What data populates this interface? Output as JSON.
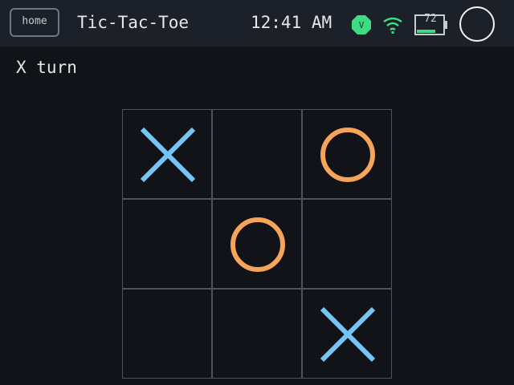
{
  "topbar": {
    "home_label": "home",
    "title": "Tic-Tac-Toe",
    "clock": "12:41 AM",
    "vpn_badge": "V",
    "battery_level": "72",
    "icons": {
      "vpn": "shield-icon",
      "wifi": "wifi-icon",
      "battery": "battery-icon",
      "power": "power-icon"
    }
  },
  "game": {
    "status": "X turn",
    "board": [
      "X",
      "",
      "O",
      "",
      "O",
      "",
      "",
      "",
      "X"
    ],
    "colors": {
      "x": "#76c6f5",
      "o": "#f5a45a",
      "grid": "#4d535c",
      "vpn": "#3ddc84",
      "wifi": "#3ddc84",
      "battery_fill": "#3ddc84"
    }
  }
}
